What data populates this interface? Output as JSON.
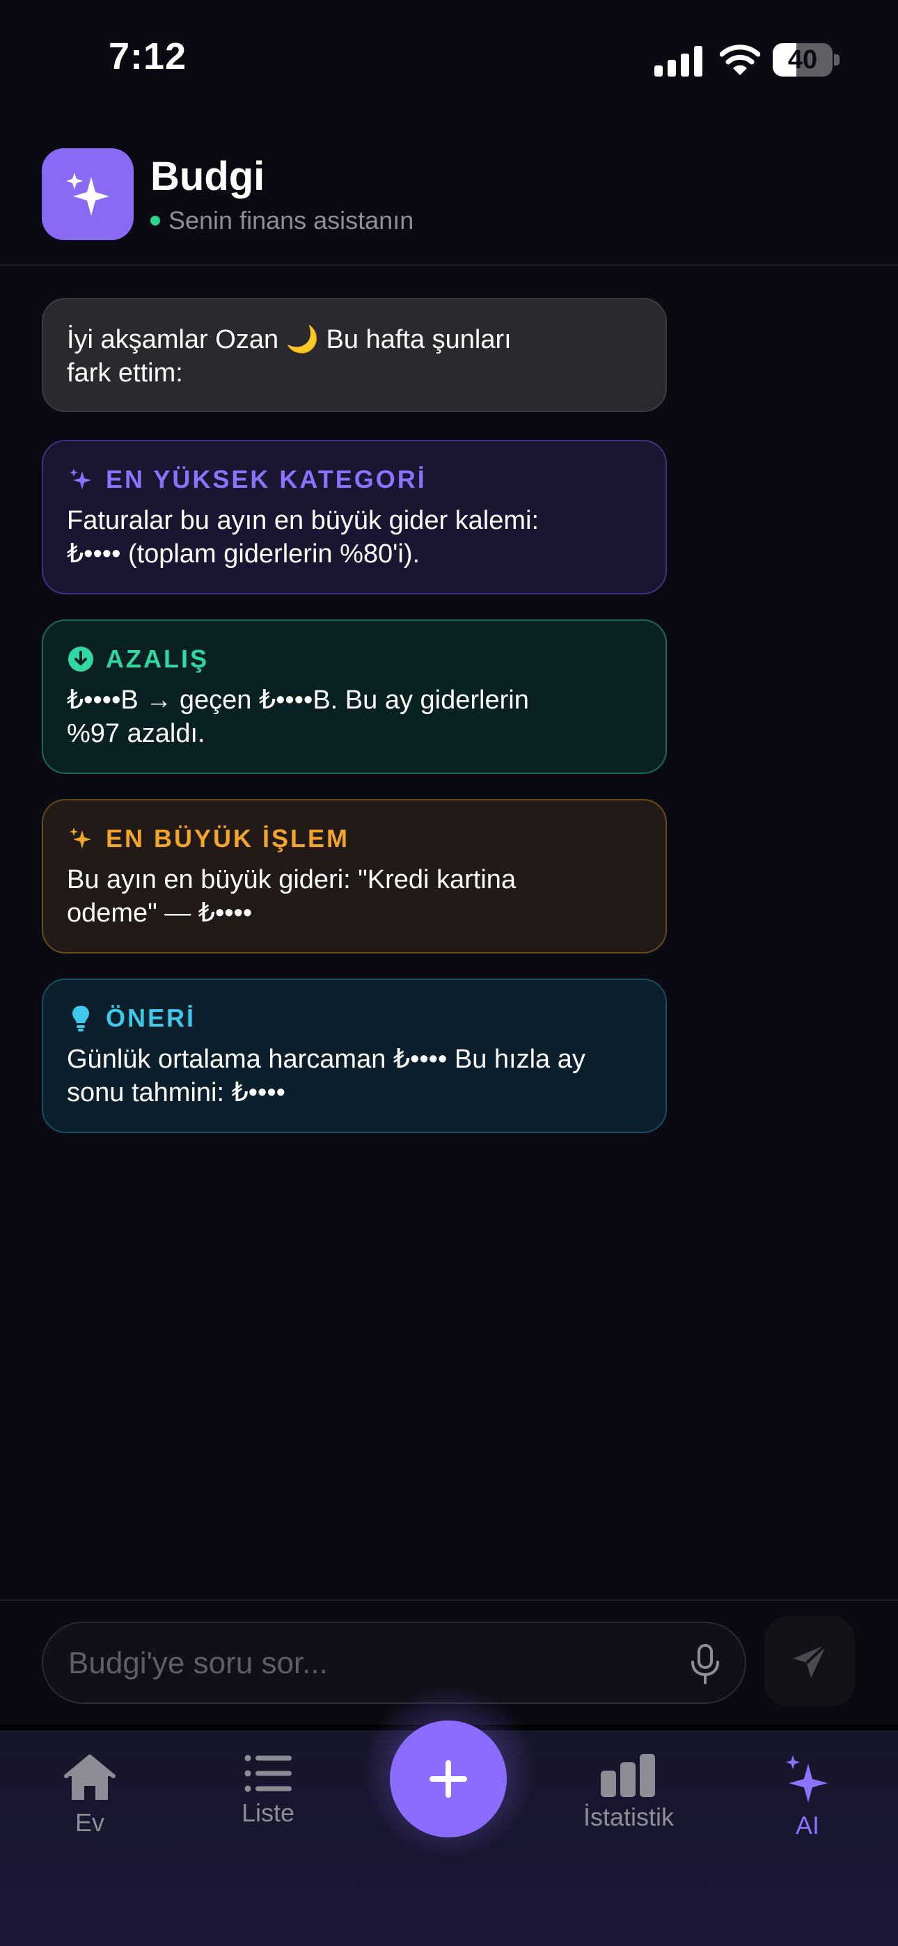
{
  "status_bar": {
    "time": "7:12",
    "battery": "40",
    "battery_level": 0.4
  },
  "header": {
    "title": "Budgi",
    "subtitle": "Senin finans asistanın"
  },
  "greeting": {
    "line1": "İyi akşamlar Ozan 🌙 Bu hafta şunları",
    "line2": "fark ettim:"
  },
  "cards": [
    {
      "title": "EN YÜKSEK KATEGORİ",
      "line1": "Faturalar bu ayın en büyük gider kalemi:",
      "line2": "₺•••• (toplam giderlerin %80'i).",
      "icon": "sparkles-icon",
      "color": "#8e72ff"
    },
    {
      "title": "AZALIŞ",
      "line1": "₺••••B → geçen ₺••••B. Bu ay giderlerin",
      "line2": "%97 azaldı.",
      "icon": "arrow-down-circle-icon",
      "color": "#2fd8a0"
    },
    {
      "title": "EN BÜYÜK İŞLEM",
      "line1": "Bu ayın en büyük gideri: \"Kredi kartina",
      "line2": "odeme\" — ₺••••",
      "icon": "sparkles-icon",
      "color": "#f2a52a"
    },
    {
      "title": "ÖNERİ",
      "line1": "Günlük ortalama harcaman ₺•••• Bu hızla ay",
      "line2": "sonu tahmini: ₺••••",
      "icon": "lightbulb-icon",
      "color": "#3ec8ea"
    }
  ],
  "chat": {
    "placeholder": "Budgi'ye soru sor..."
  },
  "tabs": [
    {
      "label": "Ev",
      "icon": "home-icon"
    },
    {
      "label": "Liste",
      "icon": "list-icon"
    },
    {
      "label": "",
      "icon": "plus-icon"
    },
    {
      "label": "İstatistik",
      "icon": "bar-chart-icon"
    },
    {
      "label": "AI",
      "icon": "sparkles-icon",
      "active": true
    }
  ],
  "colors": {
    "accent": "#8b6cff",
    "background": "#0a0a13",
    "online": "#2fd28a"
  }
}
